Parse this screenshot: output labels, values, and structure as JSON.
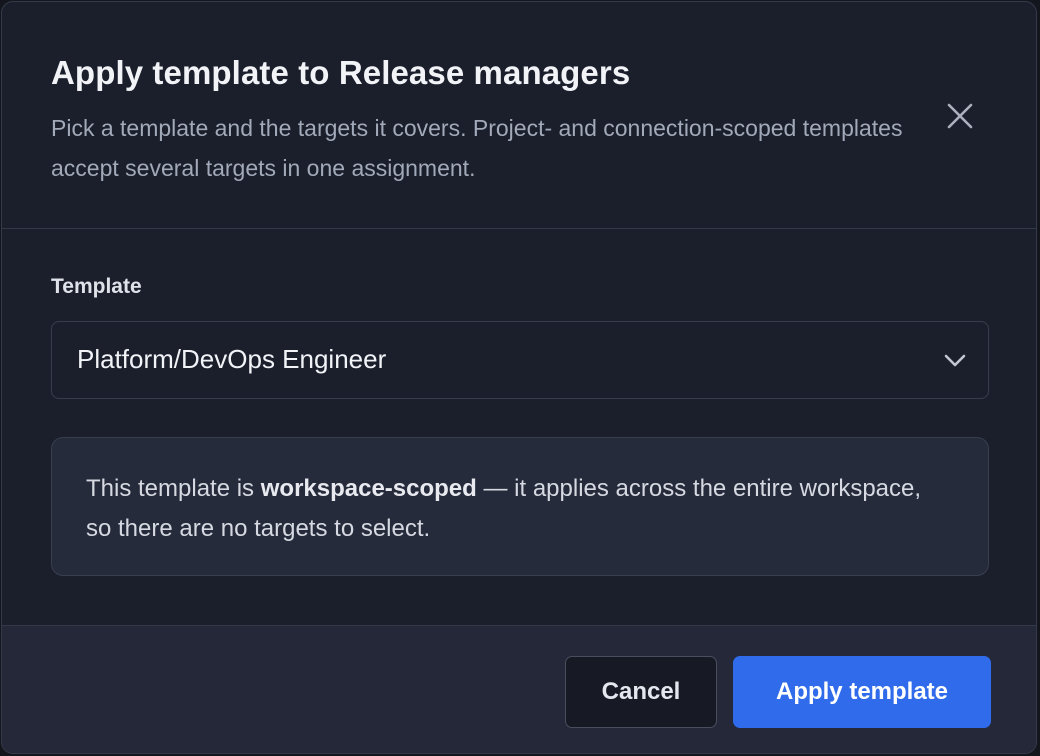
{
  "dialog": {
    "title": "Apply template to Release managers",
    "subtitle": "Pick a template and the targets it covers. Project- and connection-scoped templates accept several targets in one assignment.",
    "close_icon": "close-icon"
  },
  "template_field": {
    "label": "Template",
    "selected_value": "Platform/DevOps Engineer",
    "chevron_icon": "chevron-down-icon"
  },
  "info": {
    "prefix": "This template is ",
    "emphasis": "workspace-scoped",
    "suffix": " — it applies across the entire workspace, so there are no targets to select."
  },
  "footer": {
    "cancel_label": "Cancel",
    "apply_label": "Apply template"
  },
  "colors": {
    "background": "#1b1f2c",
    "footer": "#242838",
    "info_box": "#262b3b",
    "accent": "#2f6bea"
  }
}
